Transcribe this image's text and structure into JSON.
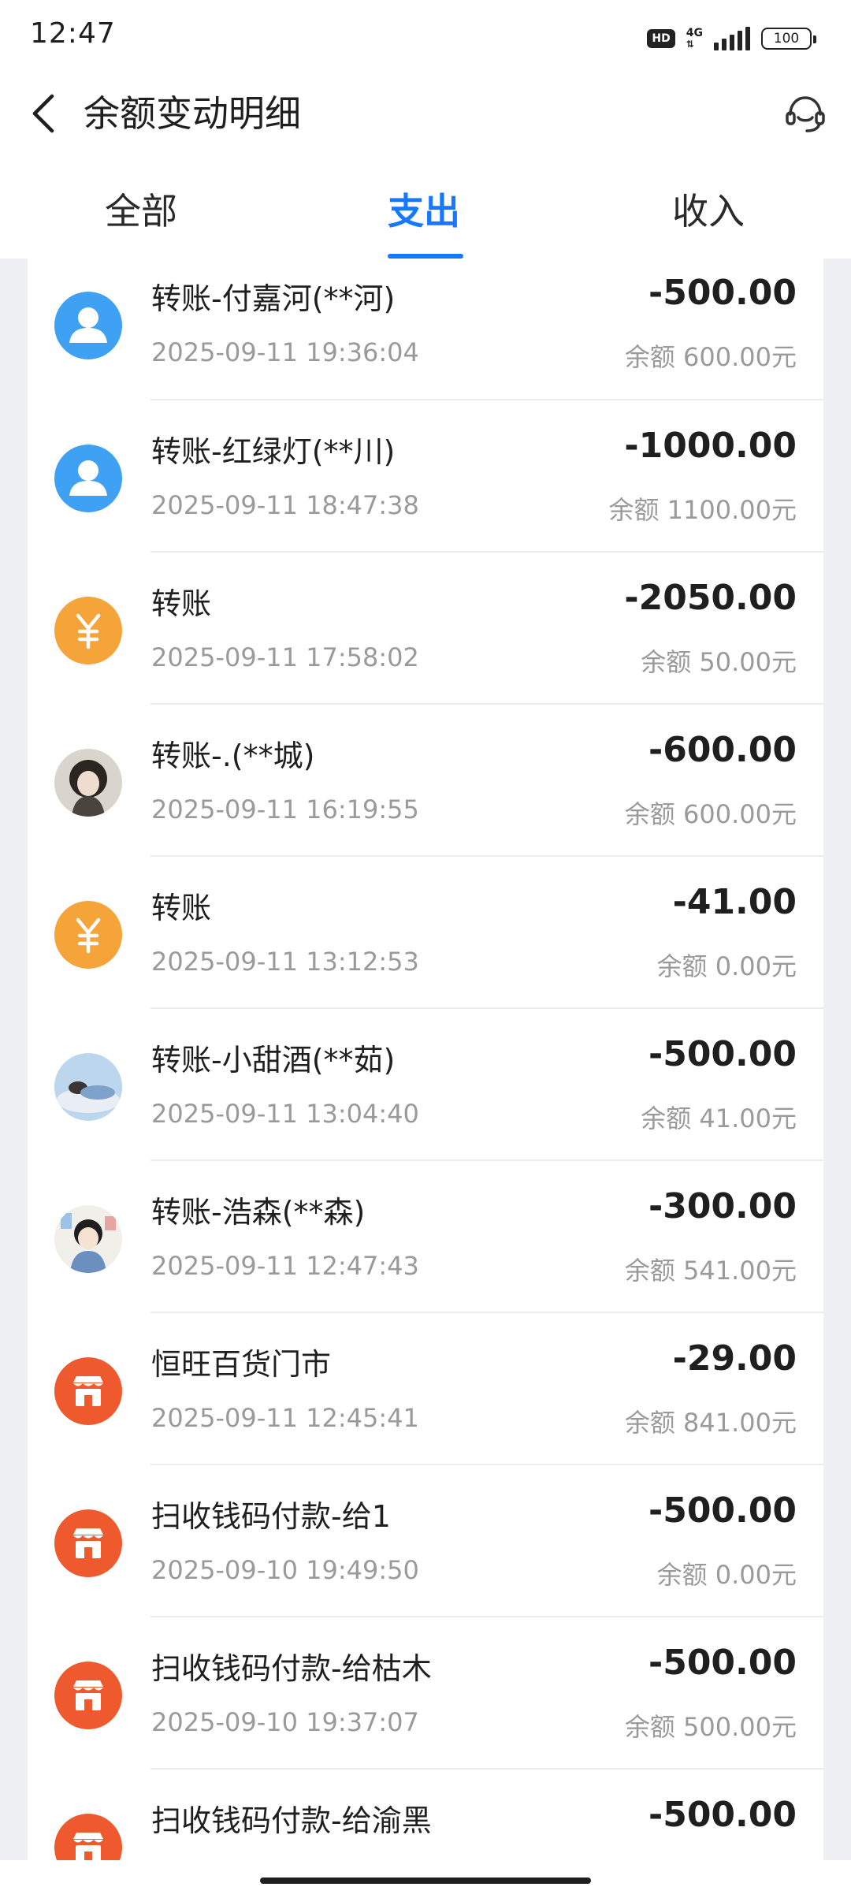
{
  "status_bar": {
    "time": "12:47",
    "hd": "HD",
    "network": "4G",
    "battery": "100"
  },
  "header": {
    "title": "余额变动明细",
    "back_icon": "chevron-left-icon",
    "service_icon": "customer-service-icon"
  },
  "tabs": [
    {
      "label": "全部",
      "active": false
    },
    {
      "label": "支出",
      "active": true
    },
    {
      "label": "收入",
      "active": false
    }
  ],
  "colors": {
    "accent": "#1677ff",
    "avatar_blue": "#3ea1f3",
    "avatar_orange": "#f5a43a",
    "avatar_red": "#ee5a2e"
  },
  "transactions": [
    {
      "title": "转账-付嘉河(**河)",
      "datetime": "2025-09-11 19:36:04",
      "amount": "-500.00",
      "balance": "余额 600.00元",
      "avatar": "person-icon"
    },
    {
      "title": "转账-红绿灯(**川)",
      "datetime": "2025-09-11 18:47:38",
      "amount": "-1000.00",
      "balance": "余额 1100.00元",
      "avatar": "person-icon"
    },
    {
      "title": "转账",
      "datetime": "2025-09-11 17:58:02",
      "amount": "-2050.00",
      "balance": "余额 50.00元",
      "avatar": "yuan-icon"
    },
    {
      "title": "转账-.(**城)",
      "datetime": "2025-09-11 16:19:55",
      "amount": "-600.00",
      "balance": "余额 600.00元",
      "avatar": "photo-avatar"
    },
    {
      "title": "转账",
      "datetime": "2025-09-11 13:12:53",
      "amount": "-41.00",
      "balance": "余额 0.00元",
      "avatar": "yuan-icon"
    },
    {
      "title": "转账-小甜酒(**茹)",
      "datetime": "2025-09-11 13:04:40",
      "amount": "-500.00",
      "balance": "余额 41.00元",
      "avatar": "photo-avatar"
    },
    {
      "title": "转账-浩森(**森)",
      "datetime": "2025-09-11 12:47:43",
      "amount": "-300.00",
      "balance": "余额 541.00元",
      "avatar": "photo-avatar"
    },
    {
      "title": "恒旺百货门市",
      "datetime": "2025-09-11 12:45:41",
      "amount": "-29.00",
      "balance": "余额 841.00元",
      "avatar": "shop-icon"
    },
    {
      "title": "扫收钱码付款-给1",
      "datetime": "2025-09-10 19:49:50",
      "amount": "-500.00",
      "balance": "余额 0.00元",
      "avatar": "shop-icon"
    },
    {
      "title": "扫收钱码付款-给枯木",
      "datetime": "2025-09-10 19:37:07",
      "amount": "-500.00",
      "balance": "余额 500.00元",
      "avatar": "shop-icon"
    },
    {
      "title": "扫收钱码付款-给渝黑",
      "amount": "-500.00",
      "avatar": "shop-icon"
    }
  ]
}
